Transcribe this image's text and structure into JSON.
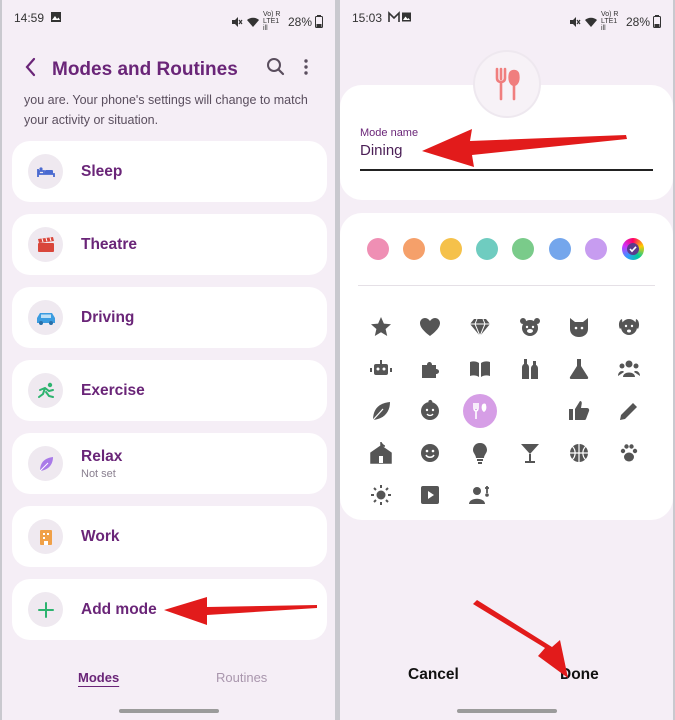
{
  "left": {
    "status": {
      "time": "14:59",
      "network": "Vo) R LTE1 ill",
      "battery": "28%"
    },
    "header": {
      "title": "Modes and Routines"
    },
    "description": "you are. Your phone's settings will change to match your activity or situation.",
    "modes": [
      {
        "label": "Sleep",
        "icon": "bed-icon",
        "sub": ""
      },
      {
        "label": "Theatre",
        "icon": "clapperboard-icon",
        "sub": ""
      },
      {
        "label": "Driving",
        "icon": "car-icon",
        "sub": ""
      },
      {
        "label": "Exercise",
        "icon": "running-icon",
        "sub": ""
      },
      {
        "label": "Relax",
        "icon": "leaf-icon",
        "sub": "Not set"
      },
      {
        "label": "Work",
        "icon": "building-icon",
        "sub": ""
      }
    ],
    "add_mode": {
      "label": "Add mode",
      "icon": "plus-icon"
    },
    "tabs": [
      {
        "label": "Modes",
        "active": true
      },
      {
        "label": "Routines",
        "active": false
      }
    ],
    "colors": {
      "accent": "#6a2578",
      "arrow": "#e21b1b"
    }
  },
  "right": {
    "status": {
      "time": "15:03",
      "network": "Vo) R LTE1 ill",
      "battery": "28%"
    },
    "mode_name_label": "Mode name",
    "mode_name_value": "Dining",
    "color_swatches": [
      "#ef8fb4",
      "#f5a06a",
      "#f5c14a",
      "#6fccc0",
      "#7acb8a",
      "#74a6ec",
      "#c79cf0",
      "gradient-selected"
    ],
    "icon_grid": [
      "star-icon",
      "heart-icon",
      "diamond-icon",
      "bear-icon",
      "cat-icon",
      "dog-icon",
      "robot-icon",
      "puzzle-icon",
      "book-icon",
      "bottles-icon",
      "flask-icon",
      "people-icon",
      "leaf-icon",
      "baby-icon",
      "gift-icon",
      "fork-knife-icon",
      "thumbs-up-icon",
      "pen-icon",
      "house-icon",
      "smile-icon",
      "bulb-icon",
      "cocktail-icon",
      "basketball-icon",
      "paw-icon",
      "sun-icon",
      "play-icon",
      "person-icon"
    ],
    "selected_icon": "fork-knife-icon",
    "cancel_label": "Cancel",
    "done_label": "Done"
  }
}
